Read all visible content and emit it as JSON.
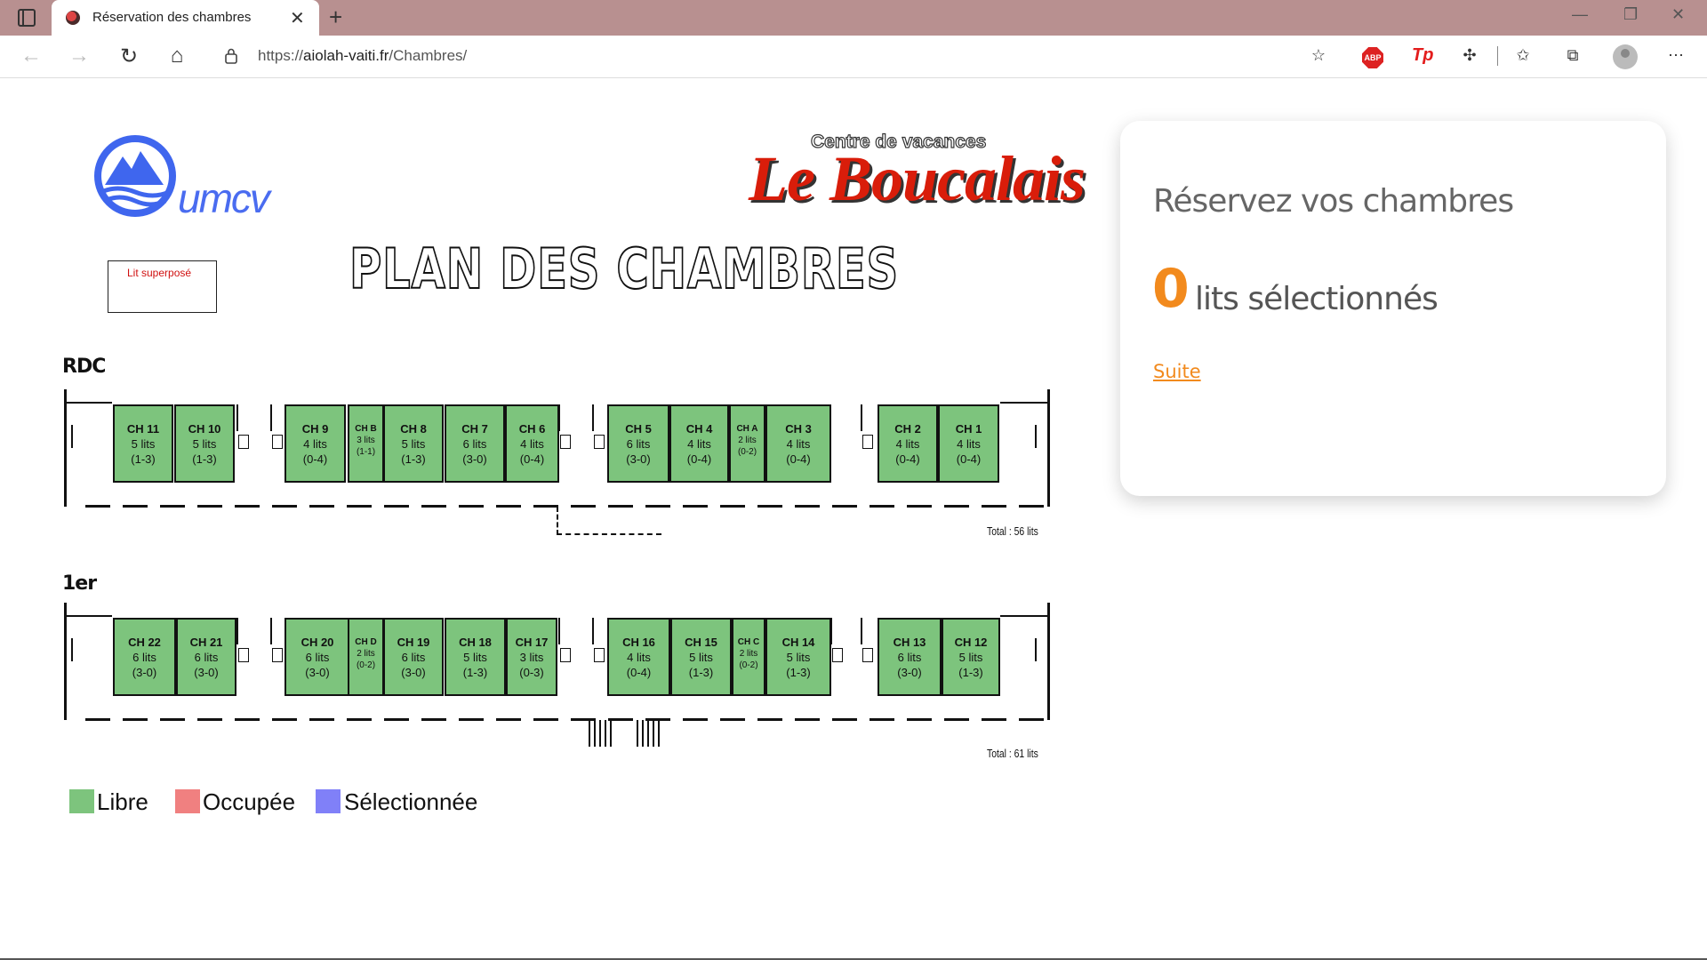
{
  "browser": {
    "tab_title": "Réservation des chambres",
    "url_prefix": "https://",
    "url_host": "aiolah-vaiti.fr",
    "url_path": "/Chambres/"
  },
  "header": {
    "umcv_logo_text": "umcv",
    "centre_text": "Centre de vacances",
    "brand_text": "Le Boucalais",
    "plan_title": "PLAN DES CHAMBRES",
    "bunk_label": "Lit superposé"
  },
  "floors": [
    {
      "label": "RDC",
      "total": "Total : 56 lits",
      "rooms": [
        {
          "name": "CH 11",
          "lits": "5 lits",
          "cfg": "(1-3)"
        },
        {
          "name": "CH 10",
          "lits": "5 lits",
          "cfg": "(1-3)"
        },
        {
          "name": "CH 9",
          "lits": "4 lits",
          "cfg": "(0-4)"
        },
        {
          "name": "CH B",
          "lits": "3 lits",
          "cfg": "(1-1)"
        },
        {
          "name": "CH 8",
          "lits": "5 lits",
          "cfg": "(1-3)"
        },
        {
          "name": "CH 7",
          "lits": "6 lits",
          "cfg": "(3-0)"
        },
        {
          "name": "CH 6",
          "lits": "4 lits",
          "cfg": "(0-4)"
        },
        {
          "name": "CH 5",
          "lits": "6 lits",
          "cfg": "(3-0)"
        },
        {
          "name": "CH 4",
          "lits": "4 lits",
          "cfg": "(0-4)"
        },
        {
          "name": "CH A",
          "lits": "2 lits",
          "cfg": "(0-2)"
        },
        {
          "name": "CH 3",
          "lits": "4 lits",
          "cfg": "(0-4)"
        },
        {
          "name": "CH 2",
          "lits": "4 lits",
          "cfg": "(0-4)"
        },
        {
          "name": "CH 1",
          "lits": "4 lits",
          "cfg": "(0-4)"
        }
      ]
    },
    {
      "label": "1er",
      "total": "Total : 61 lits",
      "rooms": [
        {
          "name": "CH 22",
          "lits": "6 lits",
          "cfg": "(3-0)"
        },
        {
          "name": "CH 21",
          "lits": "6 lits",
          "cfg": "(3-0)"
        },
        {
          "name": "CH 20",
          "lits": "6 lits",
          "cfg": "(3-0)"
        },
        {
          "name": "CH D",
          "lits": "2 lits",
          "cfg": "(0-2)"
        },
        {
          "name": "CH 19",
          "lits": "6 lits",
          "cfg": "(3-0)"
        },
        {
          "name": "CH 18",
          "lits": "5 lits",
          "cfg": "(1-3)"
        },
        {
          "name": "CH 17",
          "lits": "3 lits",
          "cfg": "(0-3)"
        },
        {
          "name": "CH 16",
          "lits": "4 lits",
          "cfg": "(0-4)"
        },
        {
          "name": "CH 15",
          "lits": "5 lits",
          "cfg": "(1-3)"
        },
        {
          "name": "CH C",
          "lits": "2 lits",
          "cfg": "(0-2)"
        },
        {
          "name": "CH 14",
          "lits": "5 lits",
          "cfg": "(1-3)"
        },
        {
          "name": "CH 13",
          "lits": "6 lits",
          "cfg": "(3-0)"
        },
        {
          "name": "CH 12",
          "lits": "5 lits",
          "cfg": "(1-3)"
        }
      ]
    }
  ],
  "legend": [
    {
      "label": "Libre",
      "color": "#7dc47d"
    },
    {
      "label": "Occupée",
      "color": "#f08080"
    },
    {
      "label": "Sélectionnée",
      "color": "#8080f8"
    }
  ],
  "card": {
    "title": "Réservez vos chambres",
    "count": "0",
    "count_label": "lits sélectionnés",
    "suite": "Suite"
  },
  "colors": {
    "libre": "#7dc47d",
    "accent": "#f28a1d"
  }
}
